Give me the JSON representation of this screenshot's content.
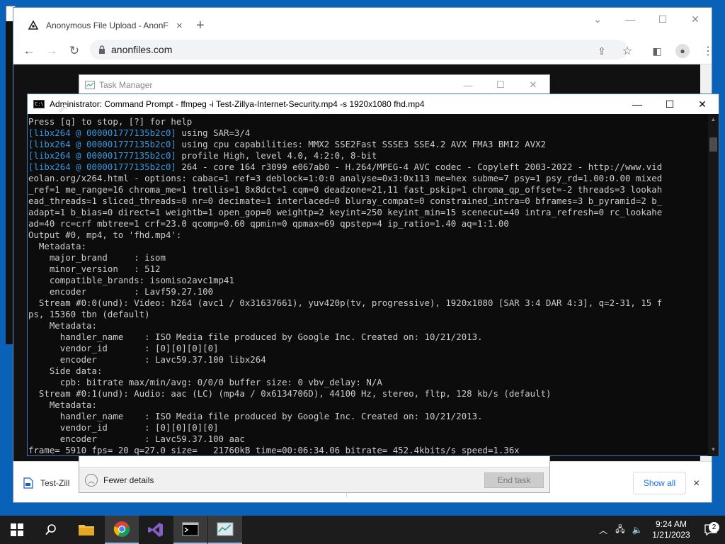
{
  "browser": {
    "tab_title": "Anonymous File Upload - AnonF",
    "tab_close": "×",
    "new_tab": "+",
    "url": "anonfiles.com",
    "downloads": {
      "file_label": "Test-Zill",
      "show_all": "Show all",
      "close": "×"
    }
  },
  "task_manager": {
    "title": "Task Manager",
    "fewer_details": "Fewer details",
    "end_task": "End task"
  },
  "cmd": {
    "title": "Administrator:  Command Prompt - ffmpeg  -i Test-Zillya-Internet-Security.mp4 -s 1920x1080 fhd.mp4",
    "lines": [
      {
        "text": "Press [q] to stop, [?] for help",
        "prefix": ""
      },
      {
        "prefix": "[libx264 @ 000001777135b2c0]",
        "text": " using SAR=3/4"
      },
      {
        "prefix": "[libx264 @ 000001777135b2c0]",
        "text": " using cpu capabilities: MMX2 SSE2Fast SSSE3 SSE4.2 AVX FMA3 BMI2 AVX2"
      },
      {
        "prefix": "[libx264 @ 000001777135b2c0]",
        "text": " profile High, level 4.0, 4:2:0, 8-bit"
      },
      {
        "prefix": "[libx264 @ 000001777135b2c0]",
        "text": " 264 - core 164 r3099 e067ab0 - H.264/MPEG-4 AVC codec - Copyleft 2003-2022 - http://www.vid"
      },
      {
        "prefix": "",
        "text": "eolan.org/x264.html - options: cabac=1 ref=3 deblock=1:0:0 analyse=0x3:0x113 me=hex subme=7 psy=1 psy_rd=1.00:0.00 mixed"
      },
      {
        "prefix": "",
        "text": "_ref=1 me_range=16 chroma_me=1 trellis=1 8x8dct=1 cqm=0 deadzone=21,11 fast_pskip=1 chroma_qp_offset=-2 threads=3 lookah"
      },
      {
        "prefix": "",
        "text": "ead_threads=1 sliced_threads=0 nr=0 decimate=1 interlaced=0 bluray_compat=0 constrained_intra=0 bframes=3 b_pyramid=2 b_"
      },
      {
        "prefix": "",
        "text": "adapt=1 b_bias=0 direct=1 weightb=1 open_gop=0 weightp=2 keyint=250 keyint_min=15 scenecut=40 intra_refresh=0 rc_lookahe"
      },
      {
        "prefix": "",
        "text": "ad=40 rc=crf mbtree=1 crf=23.0 qcomp=0.60 qpmin=0 qpmax=69 qpstep=4 ip_ratio=1.40 aq=1:1.00"
      },
      {
        "prefix": "",
        "text": "Output #0, mp4, to 'fhd.mp4':"
      },
      {
        "prefix": "",
        "text": "  Metadata:"
      },
      {
        "prefix": "",
        "text": "    major_brand     : isom"
      },
      {
        "prefix": "",
        "text": "    minor_version   : 512"
      },
      {
        "prefix": "",
        "text": "    compatible_brands: isomiso2avc1mp41"
      },
      {
        "prefix": "",
        "text": "    encoder         : Lavf59.27.100"
      },
      {
        "prefix": "",
        "text": "  Stream #0:0(und): Video: h264 (avc1 / 0x31637661), yuv420p(tv, progressive), 1920x1080 [SAR 3:4 DAR 4:3], q=2-31, 15 f"
      },
      {
        "prefix": "",
        "text": "ps, 15360 tbn (default)"
      },
      {
        "prefix": "",
        "text": "    Metadata:"
      },
      {
        "prefix": "",
        "text": "      handler_name    : ISO Media file produced by Google Inc. Created on: 10/21/2013."
      },
      {
        "prefix": "",
        "text": "      vendor_id       : [0][0][0][0]"
      },
      {
        "prefix": "",
        "text": "      encoder         : Lavc59.37.100 libx264"
      },
      {
        "prefix": "",
        "text": "    Side data:"
      },
      {
        "prefix": "",
        "text": "      cpb: bitrate max/min/avg: 0/0/0 buffer size: 0 vbv_delay: N/A"
      },
      {
        "prefix": "",
        "text": "  Stream #0:1(und): Audio: aac (LC) (mp4a / 0x6134706D), 44100 Hz, stereo, fltp, 128 kb/s (default)"
      },
      {
        "prefix": "",
        "text": "    Metadata:"
      },
      {
        "prefix": "",
        "text": "      handler_name    : ISO Media file produced by Google Inc. Created on: 10/21/2013."
      },
      {
        "prefix": "",
        "text": "      vendor_id       : [0][0][0][0]"
      },
      {
        "prefix": "",
        "text": "      encoder         : Lavc59.37.100 aac"
      },
      {
        "prefix": "",
        "text": "frame= 5910 fps= 20 q=27.0 size=   21760kB time=00:06:34.06 bitrate= 452.4kbits/s speed=1.36x"
      }
    ]
  },
  "taskbar": {
    "time": "9:24 AM",
    "date": "1/21/2023",
    "notification_count": "2"
  },
  "colors": {
    "desktop": "#0a62b8",
    "console_text": "#cccccc",
    "console_cyan": "#3a96dd",
    "taskbar": "#1c1c1c"
  }
}
